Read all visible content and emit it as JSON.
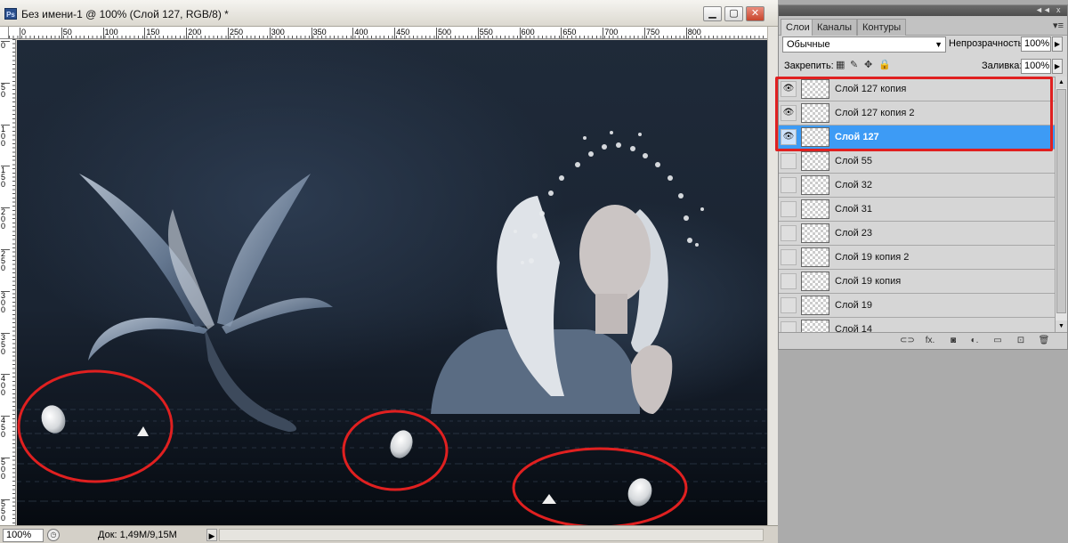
{
  "document": {
    "title": "Без имени-1 @ 100% (Слой 127, RGB/8) *",
    "app_icon": "Ps",
    "window_buttons": {
      "minimize": "▁",
      "maximize": "▢",
      "close": "✕"
    },
    "ruler_top_labels": [
      "0",
      "50",
      "100",
      "150",
      "200",
      "250",
      "300",
      "350",
      "400",
      "450",
      "500",
      "550",
      "600",
      "650",
      "700",
      "750",
      "800"
    ],
    "ruler_left_labels": [
      "0",
      "5 0",
      "1 0 0",
      "1 5 0",
      "2 0 0",
      "2 5 0",
      "3 0 0",
      "3 5 0",
      "4 0 0",
      "4 5 0",
      "5 0 0",
      "5 5 0"
    ]
  },
  "statusbar": {
    "zoom": "100%",
    "doc_size": "Док: 1,49M/9,15M",
    "arrow": "▶"
  },
  "layers_panel": {
    "collapse_icon": "◄◄",
    "close_icon": "x",
    "tabs": [
      {
        "label": "Слои",
        "active": true
      },
      {
        "label": "Каналы",
        "active": false
      },
      {
        "label": "Контуры",
        "active": false
      }
    ],
    "menu_icon": "▾≡",
    "blend_mode": "Обычные",
    "opacity_label": "Непрозрачность:",
    "opacity_value": "100%",
    "lock_label": "Закрепить:",
    "fill_label": "Заливка:",
    "fill_value": "100%",
    "layers": [
      {
        "name": "Слой 127 копия",
        "visible": true,
        "selected": false
      },
      {
        "name": "Слой 127 копия 2",
        "visible": true,
        "selected": false
      },
      {
        "name": "Слой 127",
        "visible": true,
        "selected": true
      },
      {
        "name": "Слой 55",
        "visible": false,
        "selected": false
      },
      {
        "name": "Слой 32",
        "visible": false,
        "selected": false
      },
      {
        "name": "Слой 31",
        "visible": false,
        "selected": false
      },
      {
        "name": "Слой 23",
        "visible": false,
        "selected": false
      },
      {
        "name": "Слой 19 копия 2",
        "visible": false,
        "selected": false
      },
      {
        "name": "Слой 19 копия",
        "visible": false,
        "selected": false
      },
      {
        "name": "Слой 19",
        "visible": false,
        "selected": false
      },
      {
        "name": "Слой 14",
        "visible": false,
        "selected": false
      }
    ],
    "footer_icons": [
      "link-icon",
      "fx-icon",
      "mask-icon",
      "adjustment-icon",
      "group-folder-icon",
      "new-layer-icon",
      "trash-icon"
    ],
    "footer_glyphs": [
      "⊂⊃",
      "fx.",
      "◙",
      "◐.",
      "▭",
      "⊡",
      "🗑"
    ]
  },
  "colors": {
    "selected_layer": "#3d9bf5",
    "annotation_red": "#e02020",
    "canvas_dark": "#1a2432"
  }
}
